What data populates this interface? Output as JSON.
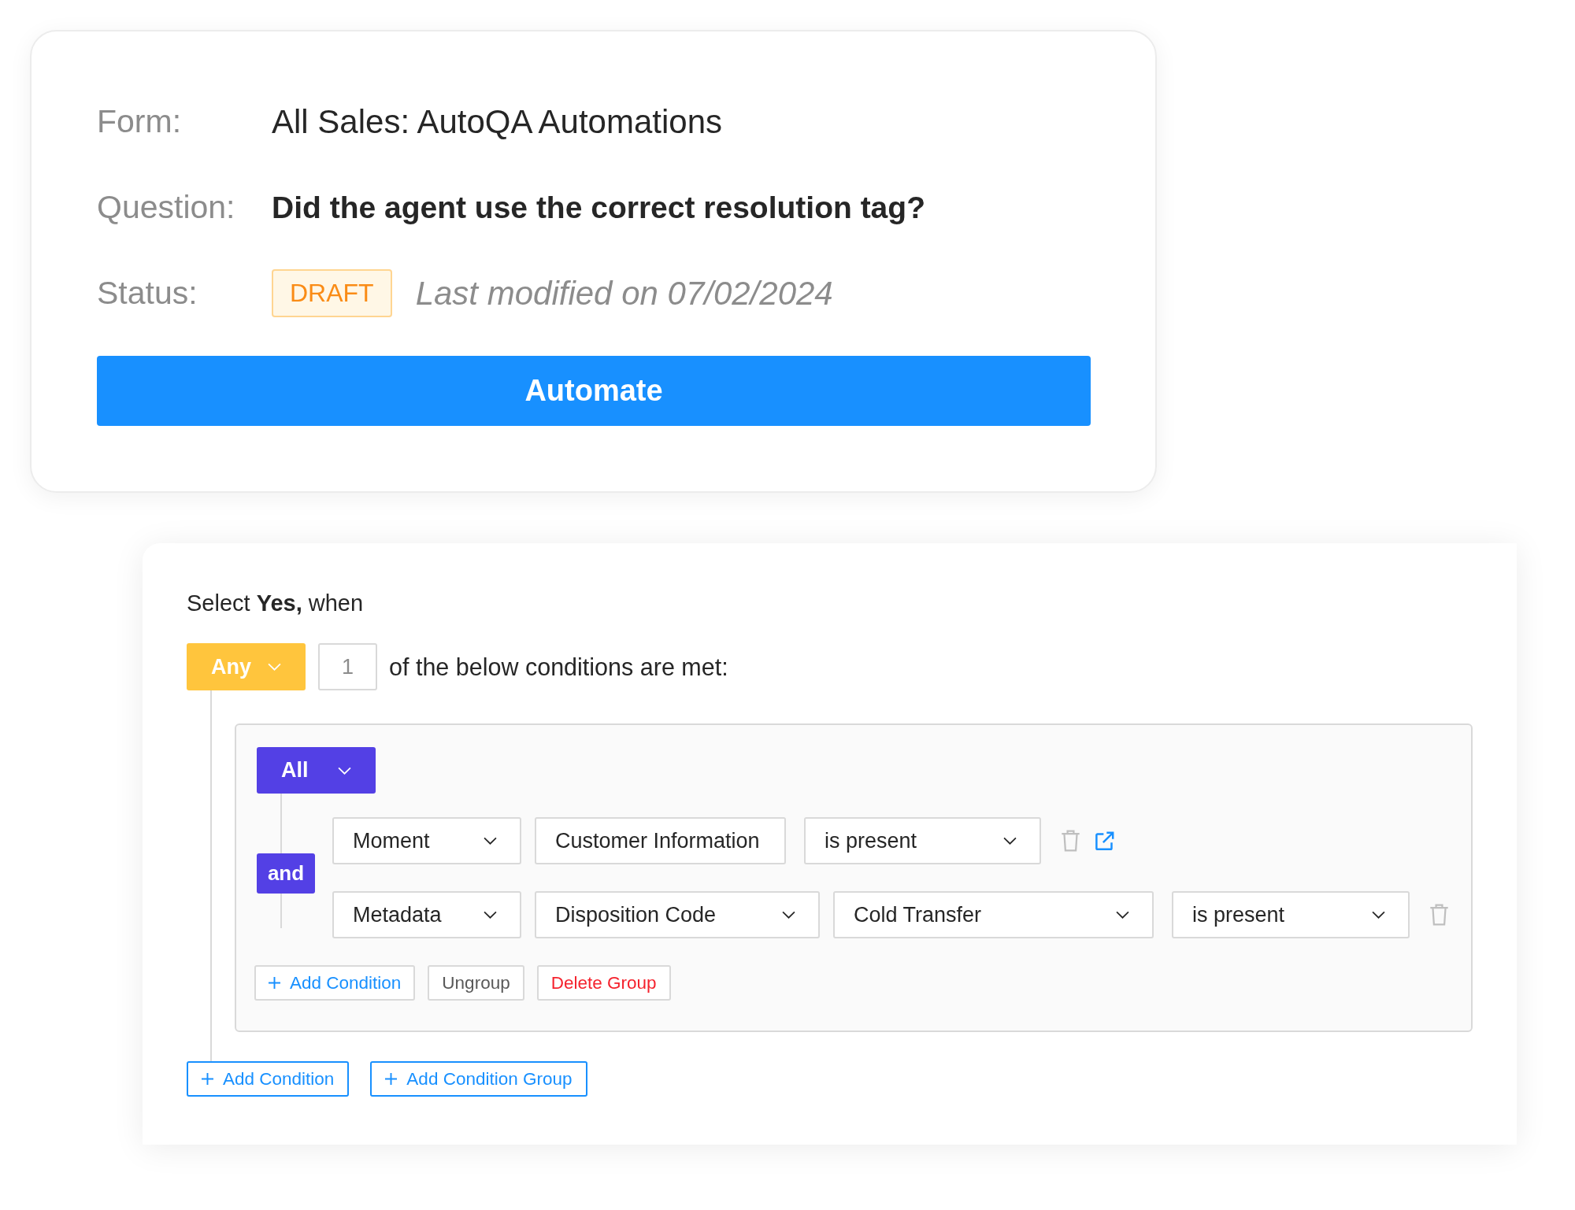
{
  "form_card": {
    "fields": [
      {
        "kind": "text",
        "label": "Form:",
        "value": "All Sales: AutoQA Automations"
      },
      {
        "kind": "question",
        "label": "Question:",
        "value": "Did the agent use the correct resolution tag?"
      },
      {
        "kind": "status",
        "label": "Status:",
        "badge": "DRAFT",
        "note": "Last modified on 07/02/2024"
      }
    ],
    "button": "Automate"
  },
  "rule_card": {
    "heading": "Select **Yes,** when",
    "match_mode": "Any",
    "match_count": "1",
    "match_text": "of the below conditions are met:",
    "group": {
      "mode": "All",
      "joiner": "and",
      "conditions": [
        {
          "fields": [
            {
              "kind": "select",
              "value": "Moment"
            },
            {
              "kind": "text",
              "value": "Customer Information"
            },
            {
              "kind": "select",
              "value": "is present"
            }
          ],
          "external_link": true
        },
        {
          "fields": [
            {
              "kind": "select",
              "value": "Metadata"
            },
            {
              "kind": "select",
              "value": "Disposition Code"
            },
            {
              "kind": "select",
              "value": "Cold Transfer"
            },
            {
              "kind": "select",
              "value": "is present"
            }
          ],
          "external_link": false
        }
      ],
      "actions": [
        {
          "kind": "add",
          "label": "Add Condition"
        },
        {
          "kind": "plain",
          "label": "Ungroup"
        },
        {
          "kind": "danger",
          "label": "Delete Group"
        }
      ]
    },
    "actions": [
      {
        "kind": "add",
        "label": "Add Condition"
      },
      {
        "kind": "add",
        "label": "Add Condition Group"
      }
    ]
  }
}
